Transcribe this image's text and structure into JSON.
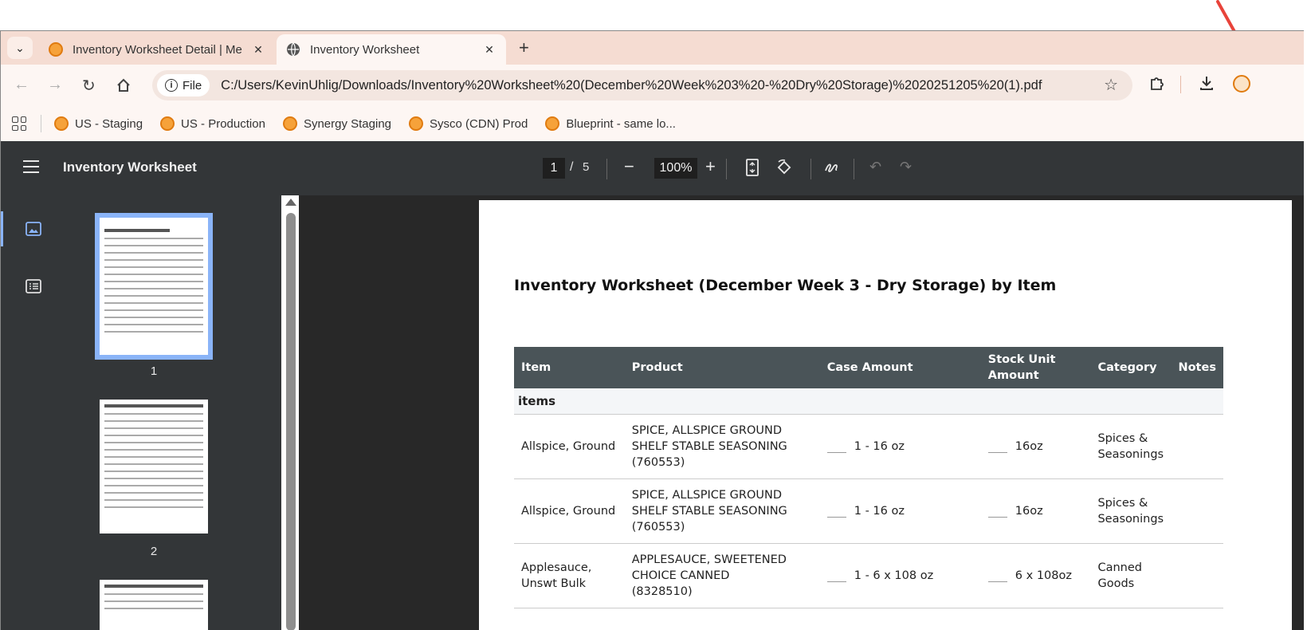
{
  "browser": {
    "tabs": [
      {
        "label": "Inventory Worksheet Detail | Me",
        "active": false
      },
      {
        "label": "Inventory Worksheet",
        "active": true
      }
    ],
    "new_tab": "+",
    "omnibox": {
      "chip": "File",
      "url": "C:/Users/KevinUhlig/Downloads/Inventory%20Worksheet%20(December%20Week%203%20-%20Dry%20Storage)%2020251205%20(1).pdf"
    },
    "bookmarks": [
      "US - Staging",
      "US - Production",
      "Synergy Staging",
      "Sysco (CDN) Prod",
      "Blueprint - same lo..."
    ]
  },
  "viewer": {
    "title": "Inventory Worksheet",
    "current_page": "1",
    "page_sep": "/",
    "total_pages": "5",
    "zoom": "100%"
  },
  "thumbnails": [
    {
      "label": "1",
      "selected": true
    },
    {
      "label": "2",
      "selected": false
    }
  ],
  "document": {
    "heading": "Inventory Worksheet (December Week 3 - Dry Storage) by Item",
    "columns": [
      "Item",
      "Product",
      "Case Amount",
      "Stock Unit Amount",
      "Category",
      "Notes"
    ],
    "group": "items",
    "rows": [
      {
        "item": "Allspice, Ground",
        "product": "SPICE, ALLSPICE GROUND SHELF STABLE SEASONING",
        "code": "(760553)",
        "case": "1 - 16 oz",
        "stock": "16oz",
        "category": "Spices & Seasonings",
        "notes": ""
      },
      {
        "item": "Allspice, Ground",
        "product": "SPICE, ALLSPICE GROUND SHELF STABLE SEASONING",
        "code": "(760553)",
        "case": "1 - 16 oz",
        "stock": "16oz",
        "category": "Spices & Seasonings",
        "notes": ""
      },
      {
        "item": "Applesauce, Unswt Bulk",
        "product": "APPLESAUCE, SWEETENED CHOICE CANNED",
        "code": "(8328510)",
        "case": "1 - 6 x 108 oz",
        "stock": "6 x 108oz",
        "category": "Canned Goods",
        "notes": ""
      }
    ]
  },
  "colors": {
    "tabbar": "#f5dcd2",
    "viewer_bar": "#333638",
    "accent": "#8ab4f8",
    "table_header": "#4a5458",
    "annotation_arrow": "#e8433a"
  }
}
